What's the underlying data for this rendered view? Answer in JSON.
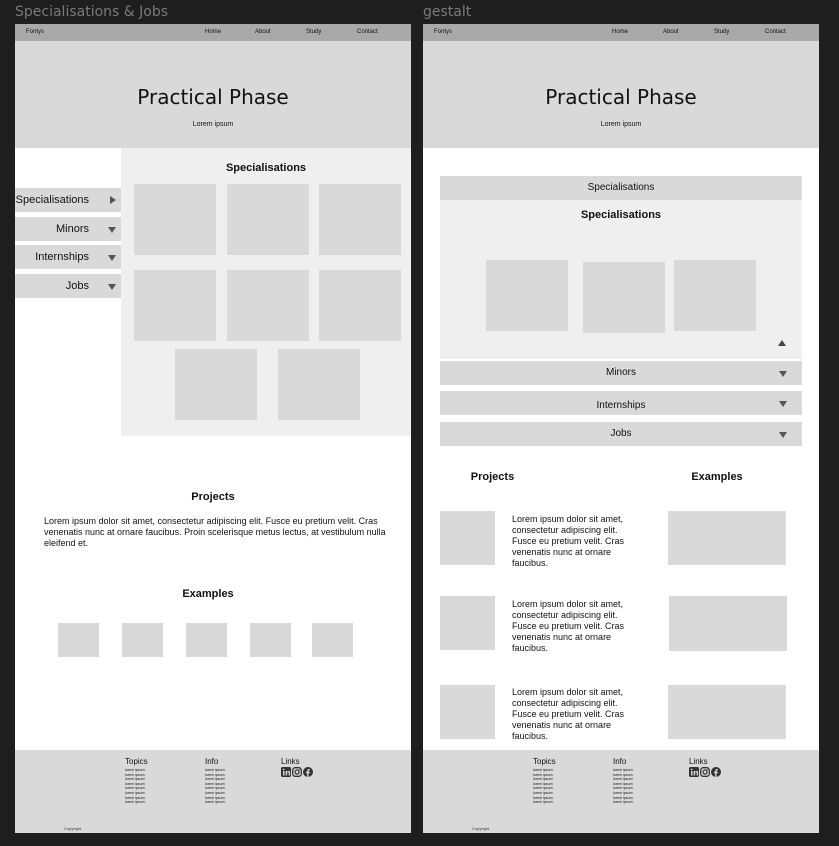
{
  "frames": [
    {
      "name": "Specialisations & Jobs",
      "nav": {
        "brand": "Fontys",
        "links": [
          "Home",
          "About",
          "Study",
          "Contact"
        ]
      },
      "hero": {
        "title": "Practical Phase",
        "subtitle": "Lorem ipsum"
      },
      "side_menu": [
        {
          "label": "Specialisations",
          "icon": "triangle-right-icon"
        },
        {
          "label": "Minors",
          "icon": "triangle-down-icon"
        },
        {
          "label": "Internships",
          "icon": "triangle-down-icon"
        },
        {
          "label": "Jobs",
          "icon": "triangle-down-icon"
        }
      ],
      "specialisations_heading": "Specialisations",
      "projects_heading": "Projects",
      "projects_text": "Lorem ipsum dolor sit amet, consectetur adipiscing elit. Fusce eu pretium velit. Cras venenatis nunc at ornare faucibus. Proin scelerisque metus lectus, at vestibulum nulla eleifend et.",
      "examples_heading": "Examples",
      "footer": {
        "topics_heading": "Topics",
        "info_heading": "Info",
        "links_heading": "Links",
        "item_text": "lorem ipsum",
        "copyright": "Copyright"
      }
    },
    {
      "name": "gestalt",
      "nav": {
        "brand": "Fontys",
        "links": [
          "Home",
          "About",
          "Study",
          "Contact"
        ]
      },
      "hero": {
        "title": "Practical Phase",
        "subtitle": "Lorem ipsum"
      },
      "accordion": [
        {
          "label": "Specialisations",
          "expanded": true
        },
        {
          "label": "Minors",
          "expanded": false
        },
        {
          "label": "Internships",
          "expanded": false
        },
        {
          "label": "Jobs",
          "expanded": false
        }
      ],
      "specialisations_heading": "Specialisations",
      "projects_heading": "Projects",
      "examples_heading": "Examples",
      "project_text": "Lorem ipsum dolor sit amet, consectetur adipiscing elit. Fusce eu pretium velit. Cras venenatis nunc at ornare faucibus.",
      "footer": {
        "topics_heading": "Topics",
        "info_heading": "Info",
        "links_heading": "Links",
        "item_text": "lorem ipsum",
        "copyright": "Copyright"
      }
    }
  ],
  "colors": {
    "canvas": "#1e1e1e",
    "nav": "#a9a9a9",
    "placeholder": "#d9d9d9",
    "panel": "#efefef"
  }
}
